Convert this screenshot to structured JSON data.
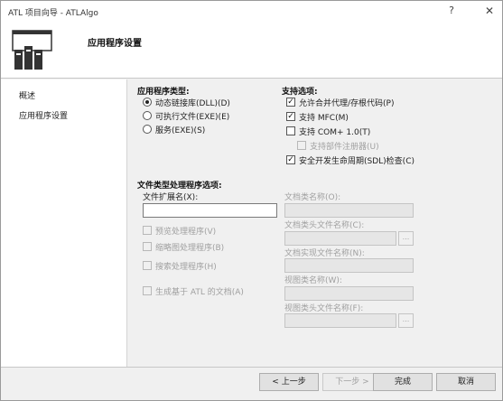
{
  "window": {
    "title": "ATL 项目向导 - ATLAlgo",
    "help_glyph": "?",
    "close_glyph": "✕"
  },
  "header": {
    "title": "应用程序设置",
    "logo_icon": "wizard-app-icon"
  },
  "nav": {
    "items": [
      {
        "label": "概述"
      },
      {
        "label": "应用程序设置"
      }
    ]
  },
  "app_type": {
    "label": "应用程序类型:",
    "options": [
      {
        "label": "动态链接库(DLL)(D)",
        "selected": true
      },
      {
        "label": "可执行文件(EXE)(E)",
        "selected": false
      },
      {
        "label": "服务(EXE)(S)",
        "selected": false
      }
    ]
  },
  "support": {
    "label": "支持选项:",
    "options": [
      {
        "label": "允许合并代理/存根代码(P)",
        "checked": true,
        "enabled": true
      },
      {
        "label": "支持 MFC(M)",
        "checked": true,
        "enabled": true
      },
      {
        "label": "支持 COM+ 1.0(T)",
        "checked": false,
        "enabled": true
      },
      {
        "label": "支持部件注册器(U)",
        "checked": false,
        "enabled": false
      },
      {
        "label": "安全开发生命周期(SDL)检查(C)",
        "checked": true,
        "enabled": true
      }
    ]
  },
  "file_type": {
    "label": "文件类型处理程序选项:",
    "ext_label": "文件扩展名(X):",
    "ext_value": "",
    "checks": [
      {
        "label": "预览处理程序(V)"
      },
      {
        "label": "缩略图处理程序(B)"
      },
      {
        "label": "搜索处理程序(H)"
      },
      {
        "label": "生成基于 ATL 的文档(A)"
      }
    ],
    "fields": [
      {
        "label": "文档类名称(O):",
        "browse": false
      },
      {
        "label": "文档类头文件名称(C):",
        "browse": true
      },
      {
        "label": "文档实现文件名称(N):",
        "browse": false
      },
      {
        "label": "视图类名称(W):",
        "browse": false
      },
      {
        "label": "视图类头文件名称(F):",
        "browse": true
      }
    ],
    "browse_label": "..."
  },
  "buttons": {
    "prev": "< 上一步",
    "next": "下一步 >",
    "finish": "完成",
    "cancel": "取消"
  },
  "colors": {
    "window_bg": "#f0f0f0",
    "panel_bg": "#ffffff",
    "disabled_text": "#a0a0a0"
  }
}
